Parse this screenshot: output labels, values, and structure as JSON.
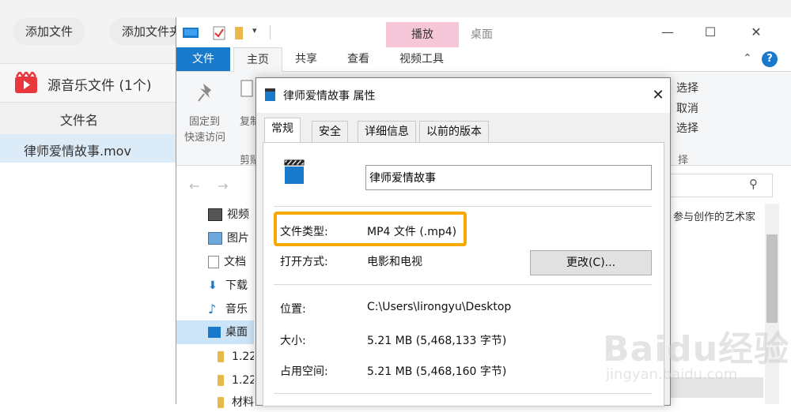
{
  "app": {
    "buttons": [
      "添加文件",
      "添加文件夹"
    ],
    "section_title": "源音乐文件 (1个)",
    "column_header": "文件名",
    "file_name": "律师爱情故事.mov",
    "accent_color": "#e8383d"
  },
  "explorer": {
    "title": "桌面",
    "context_tab": "播放",
    "ribbon_tabs": [
      "文件",
      "主页",
      "共享",
      "查看",
      "视频工具"
    ],
    "ribbon_left": {
      "pin_line1": "固定到",
      "pin_line2": "快速访问",
      "copy": "复制",
      "group": "剪贴"
    },
    "ribbon_right": {
      "select_all": "选择",
      "select_none": "取消",
      "invert": "选择",
      "group": "择"
    },
    "sidebar": [
      {
        "label": "视频",
        "icon": "video-icon"
      },
      {
        "label": "图片",
        "icon": "picture-icon"
      },
      {
        "label": "文档",
        "icon": "document-icon"
      },
      {
        "label": "下载",
        "icon": "download-icon"
      },
      {
        "label": "音乐",
        "icon": "music-icon"
      },
      {
        "label": "桌面",
        "icon": "desktop-icon"
      },
      {
        "label": "1.22",
        "icon": "folder-icon"
      },
      {
        "label": "1.22",
        "icon": "folder-icon"
      },
      {
        "label": "材料",
        "icon": "folder-icon"
      }
    ],
    "right_text": "参与创作的艺术家"
  },
  "dialog": {
    "title": "律师爱情故事 属性",
    "tabs": [
      "常规",
      "安全",
      "详细信息",
      "以前的版本"
    ],
    "name_value": "律师爱情故事",
    "properties": {
      "type_label": "文件类型:",
      "type_value": "MP4 文件 (.mp4)",
      "open_label": "打开方式:",
      "open_value": "电影和电视",
      "change_button": "更改(C)...",
      "location_label": "位置:",
      "location_value": "C:\\Users\\lirongyu\\Desktop",
      "size_label": "大小:",
      "size_value": "5.21 MB (5,468,133 字节)",
      "disk_label": "占用空间:",
      "disk_value": "5.21 MB (5,468,160 字节)"
    },
    "highlight_color": "#f5a800"
  },
  "watermark": {
    "logo": "Baidu经验",
    "url": "jingyan.baidu.com"
  }
}
